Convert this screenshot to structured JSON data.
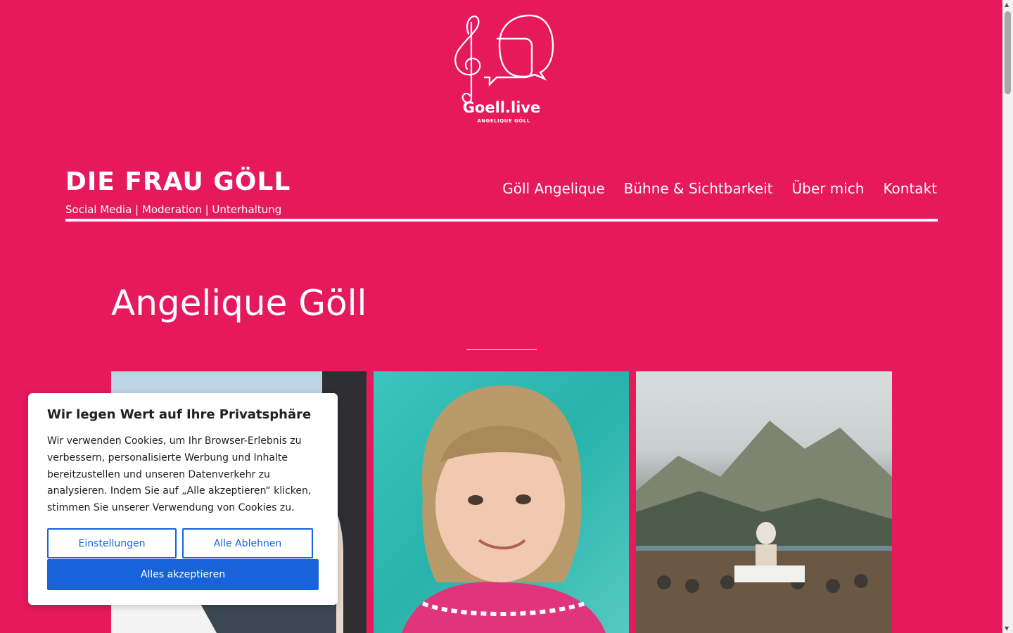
{
  "logo": {
    "brand_text": "Goell.live",
    "sub_text": "ANGELIQUE GÖLL"
  },
  "header": {
    "site_title": "DIE FRAU GÖLL",
    "tagline": "Social Media | Moderation | Unterhaltung",
    "nav": [
      {
        "label": "Göll Angelique"
      },
      {
        "label": "Bühne & Sichtbarkeit"
      },
      {
        "label": "Über mich"
      },
      {
        "label": "Kontakt"
      }
    ]
  },
  "main": {
    "title": "Angelique Göll"
  },
  "cookie_banner": {
    "title": "Wir legen Wert auf Ihre Privatsphäre",
    "text": "Wir verwenden Cookies, um Ihr Browser-Erlebnis zu verbessern, personalisierte Werbung und Inhalte bereitzustellen und unseren Datenverkehr zu analysieren. Indem Sie auf „Alle akzeptieren“ klicken, stimmen Sie unserer Verwendung von Cookies zu.",
    "settings_label": "Einstellungen",
    "reject_label": "Alle Ablehnen",
    "accept_label": "Alles akzeptieren"
  },
  "colors": {
    "background": "#e5195c",
    "text": "#ffffff",
    "button_primary": "#1863dc"
  }
}
